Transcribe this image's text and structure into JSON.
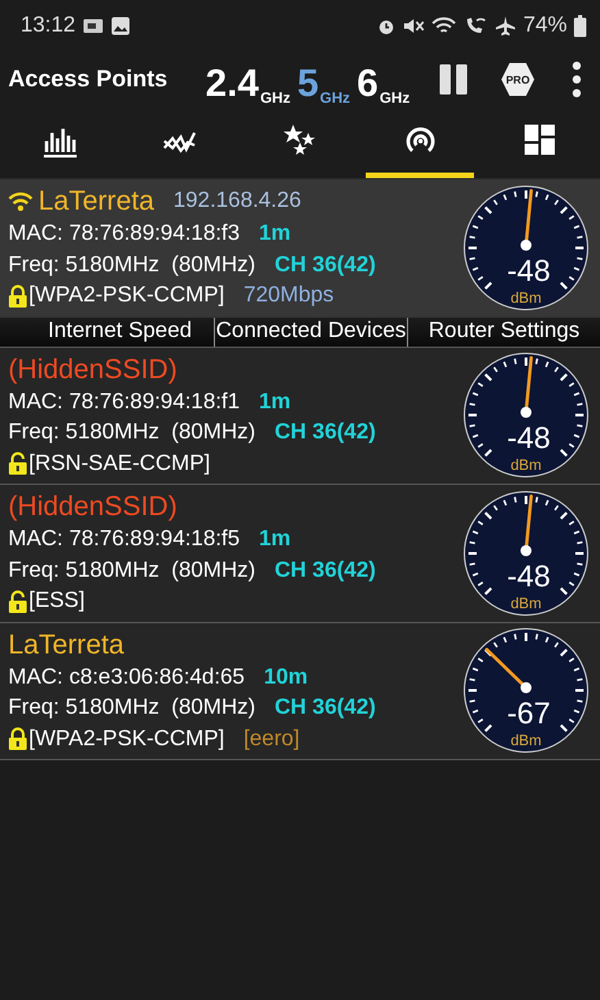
{
  "status_bar": {
    "time": "13:12",
    "battery": "74%"
  },
  "app_bar": {
    "title": "Access Points",
    "bands": [
      {
        "number": "2.4",
        "unit": "GHz",
        "selected": false
      },
      {
        "number": "5",
        "unit": "GHz",
        "selected": true
      },
      {
        "number": "6",
        "unit": "GHz",
        "selected": false
      }
    ],
    "pro_badge": "PRO"
  },
  "tabs": [
    {
      "selected": false
    },
    {
      "selected": false
    },
    {
      "selected": false
    },
    {
      "selected": true
    },
    {
      "selected": false
    }
  ],
  "access_points": [
    {
      "ssid": "LaTerreta",
      "hidden": false,
      "connected": true,
      "ip": "192.168.4.26",
      "mac": "MAC: 78:76:89:94:18:f3",
      "distance": "1m",
      "freq": "Freq: 5180MHz  (80MHz)",
      "channel": "CH 36(42)",
      "security": "[WPA2-PSK-CCMP]",
      "locked": true,
      "link_speed": "720Mbps",
      "signal": "-48",
      "unit": "dBm",
      "actions": [
        "Internet Speed",
        "Connected Devices",
        "Router Settings"
      ]
    },
    {
      "ssid": "(HiddenSSID)",
      "hidden": true,
      "connected": false,
      "mac": "MAC: 78:76:89:94:18:f1",
      "distance": "1m",
      "freq": "Freq: 5180MHz  (80MHz)",
      "channel": "CH 36(42)",
      "security": "[RSN-SAE-CCMP]",
      "locked": false,
      "signal": "-48",
      "unit": "dBm"
    },
    {
      "ssid": "(HiddenSSID)",
      "hidden": true,
      "connected": false,
      "mac": "MAC: 78:76:89:94:18:f5",
      "distance": "1m",
      "freq": "Freq: 5180MHz  (80MHz)",
      "channel": "CH 36(42)",
      "security": "[ESS]",
      "locked": false,
      "signal": "-48",
      "unit": "dBm"
    },
    {
      "ssid": "LaTerreta",
      "hidden": false,
      "connected": false,
      "mac": "MAC: c8:e3:06:86:4d:65",
      "distance": "10m",
      "freq": "Freq: 5180MHz  (80MHz)",
      "channel": "CH 36(42)",
      "security": "[WPA2-PSK-CCMP]",
      "locked": true,
      "vendor": "[eero]",
      "signal": "-67",
      "unit": "dBm"
    }
  ]
}
